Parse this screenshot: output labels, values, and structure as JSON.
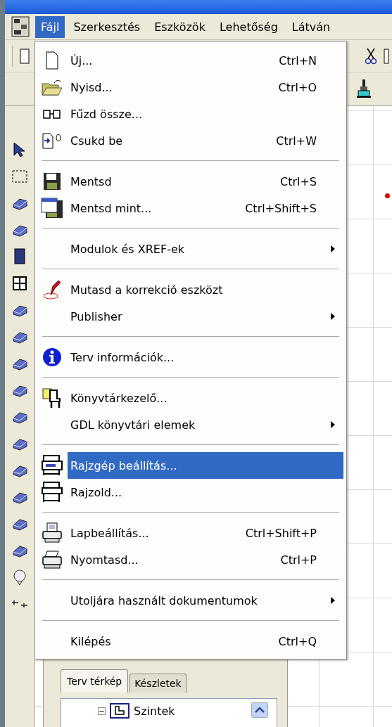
{
  "menubar": {
    "items": [
      {
        "label": "Fájl",
        "selected": true
      },
      {
        "label": "Szerkesztés",
        "selected": false
      },
      {
        "label": "Eszközök",
        "selected": false
      },
      {
        "label": "Lehetőség",
        "selected": false
      },
      {
        "label": "Látván",
        "selected": false
      }
    ]
  },
  "menu": {
    "items": [
      {
        "kind": "item",
        "label": "Új...",
        "shortcut": "Ctrl+N",
        "submenu": false,
        "selected": false
      },
      {
        "kind": "item",
        "label": "Nyisd...",
        "shortcut": "Ctrl+O",
        "submenu": false,
        "selected": false
      },
      {
        "kind": "item",
        "label": "Fűzd össze...",
        "submenu": false,
        "selected": false
      },
      {
        "kind": "item",
        "label": "Csukd be",
        "shortcut": "Ctrl+W",
        "submenu": false,
        "selected": false
      },
      {
        "kind": "separator"
      },
      {
        "kind": "item",
        "label": "Mentsd",
        "shortcut": "Ctrl+S",
        "submenu": false,
        "selected": false
      },
      {
        "kind": "item",
        "label": "Mentsd mint...",
        "shortcut": "Ctrl+Shift+S",
        "submenu": false,
        "selected": false
      },
      {
        "kind": "separator"
      },
      {
        "kind": "item",
        "label": "Modulok és XREF-ek",
        "submenu": true,
        "selected": false
      },
      {
        "kind": "separator"
      },
      {
        "kind": "item",
        "label": "Mutasd a korrekció eszközt",
        "submenu": false,
        "selected": false
      },
      {
        "kind": "item",
        "label": "Publisher",
        "submenu": true,
        "selected": false
      },
      {
        "kind": "separator"
      },
      {
        "kind": "item",
        "label": "Terv információk...",
        "submenu": false,
        "selected": false
      },
      {
        "kind": "separator"
      },
      {
        "kind": "item",
        "label": "Könyvtárkezelő...",
        "submenu": false,
        "selected": false
      },
      {
        "kind": "item",
        "label": "GDL könyvtári elemek",
        "submenu": true,
        "selected": false
      },
      {
        "kind": "separator"
      },
      {
        "kind": "item",
        "label": "Rajzgép beállítás...",
        "submenu": false,
        "selected": true
      },
      {
        "kind": "item",
        "label": "Rajzold...",
        "submenu": false,
        "selected": false
      },
      {
        "kind": "separator"
      },
      {
        "kind": "item",
        "label": "Lapbeállítás...",
        "shortcut": "Ctrl+Shift+P",
        "submenu": false,
        "selected": false
      },
      {
        "kind": "item",
        "label": "Nyomtasd...",
        "shortcut": "Ctrl+P",
        "submenu": false,
        "selected": false
      },
      {
        "kind": "separator"
      },
      {
        "kind": "item",
        "label": "Utoljára használt dokumentumok",
        "submenu": true,
        "selected": false
      },
      {
        "kind": "separator"
      },
      {
        "kind": "item",
        "label": "Kilépés",
        "shortcut": "Ctrl+Q",
        "submenu": false,
        "selected": false
      }
    ]
  },
  "navigator": {
    "tabs": [
      {
        "label": "Terv térkép",
        "selected": true
      },
      {
        "label": "Készletek",
        "selected": false
      }
    ],
    "tree": [
      {
        "label": "Szintek",
        "expanded": true
      }
    ]
  }
}
